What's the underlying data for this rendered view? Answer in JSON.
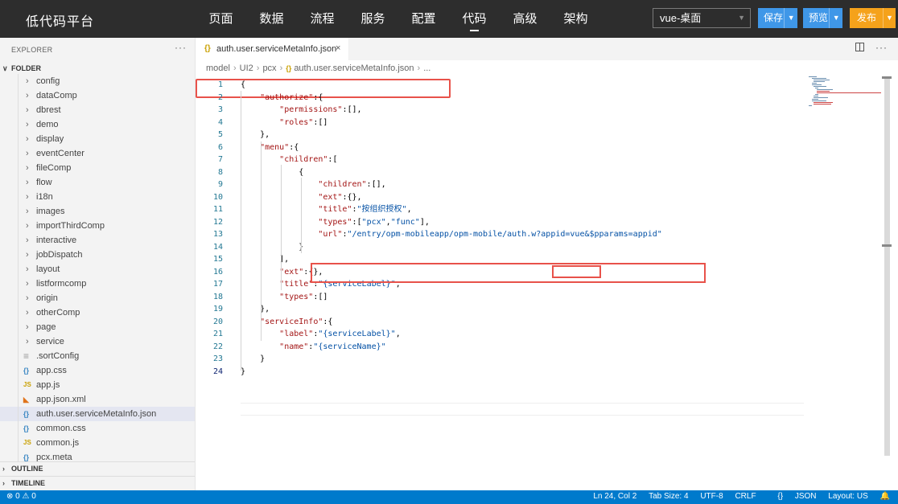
{
  "app": {
    "title": "低代码平台"
  },
  "nav": [
    {
      "label": "页面"
    },
    {
      "label": "数据"
    },
    {
      "label": "流程"
    },
    {
      "label": "服务"
    },
    {
      "label": "配置"
    },
    {
      "label": "代码"
    },
    {
      "label": "高级"
    },
    {
      "label": "架构"
    }
  ],
  "nav_active": "代码",
  "toolbar": {
    "env": "vue-桌面",
    "save": "保存",
    "preview": "预览",
    "publish": "发布"
  },
  "sidebar": {
    "explorer_title": "EXPLORER",
    "more": "···",
    "folder_label": "FOLDER",
    "items": [
      {
        "name": "config",
        "type": "folder"
      },
      {
        "name": "dataComp",
        "type": "folder"
      },
      {
        "name": "dbrest",
        "type": "folder"
      },
      {
        "name": "demo",
        "type": "folder"
      },
      {
        "name": "display",
        "type": "folder"
      },
      {
        "name": "eventCenter",
        "type": "folder"
      },
      {
        "name": "fileComp",
        "type": "folder"
      },
      {
        "name": "flow",
        "type": "folder"
      },
      {
        "name": "i18n",
        "type": "folder"
      },
      {
        "name": "images",
        "type": "folder"
      },
      {
        "name": "importThirdComp",
        "type": "folder"
      },
      {
        "name": "interactive",
        "type": "folder"
      },
      {
        "name": "jobDispatch",
        "type": "folder"
      },
      {
        "name": "layout",
        "type": "folder"
      },
      {
        "name": "listformcomp",
        "type": "folder"
      },
      {
        "name": "origin",
        "type": "folder"
      },
      {
        "name": "otherComp",
        "type": "folder"
      },
      {
        "name": "page",
        "type": "folder"
      },
      {
        "name": "service",
        "type": "folder"
      },
      {
        "name": ".sortConfig",
        "type": "file"
      },
      {
        "name": "app.css",
        "type": "css"
      },
      {
        "name": "app.js",
        "type": "js"
      },
      {
        "name": "app.json.xml",
        "type": "xml"
      },
      {
        "name": "auth.user.serviceMetaInfo.json",
        "type": "json",
        "selected": true
      },
      {
        "name": "common.css",
        "type": "css"
      },
      {
        "name": "common.js",
        "type": "js"
      },
      {
        "name": "pcx.meta",
        "type": "json"
      }
    ],
    "outline_label": "OUTLINE",
    "timeline_label": "TIMELINE"
  },
  "icons": {
    "folder_chevron": "chevron-right-icon",
    "json": "{}",
    "css": "{}",
    "js": "JS",
    "xml": "rss-icon",
    "file": "lines-icon"
  },
  "editor": {
    "tab_name": "auth.user.serviceMetaInfo.json",
    "tab_close": "×",
    "more": "···",
    "breadcrumb": {
      "parts": [
        "model",
        "UI2",
        "pcx"
      ],
      "file": "auth.user.serviceMetaInfo.json",
      "ellipsis": "..."
    },
    "lines": [
      {
        "n": "1",
        "text": "{"
      },
      {
        "n": "2",
        "text": "    \"authorize\":{"
      },
      {
        "n": "3",
        "text": "        \"permissions\":[],"
      },
      {
        "n": "4",
        "text": "        \"roles\":[]"
      },
      {
        "n": "5",
        "text": "    },"
      },
      {
        "n": "6",
        "text": "    \"menu\":{"
      },
      {
        "n": "7",
        "text": "        \"children\":["
      },
      {
        "n": "8",
        "text": "            {"
      },
      {
        "n": "9",
        "text": "                \"children\":[],"
      },
      {
        "n": "10",
        "text": "                \"ext\":{},"
      },
      {
        "n": "11",
        "text": "                \"title\":\"按组织授权\","
      },
      {
        "n": "12",
        "text": "                \"types\":[\"pcx\",\"func\"],"
      },
      {
        "n": "13",
        "text": "                \"url\":\"/entry/opm-mobileapp/opm-mobile/auth.w?appid=vue&$pparams=appid\""
      },
      {
        "n": "14",
        "text": "            }"
      },
      {
        "n": "15",
        "text": "        ],"
      },
      {
        "n": "16",
        "text": "        \"ext\":{},"
      },
      {
        "n": "17",
        "text": "        \"title\":\"{serviceLabel}\","
      },
      {
        "n": "18",
        "text": "        \"types\":[]"
      },
      {
        "n": "19",
        "text": "    },"
      },
      {
        "n": "20",
        "text": "    \"serviceInfo\":{"
      },
      {
        "n": "21",
        "text": "        \"label\":\"{serviceLabel}\","
      },
      {
        "n": "22",
        "text": "        \"name\":\"{serviceName}\""
      },
      {
        "n": "23",
        "text": "    }"
      },
      {
        "n": "24",
        "text": "}"
      }
    ],
    "current_line": "24"
  },
  "status": {
    "errors": "0",
    "warnings": "0",
    "position": "Ln 24, Col 2",
    "tab_size": "Tab Size: 4",
    "encoding": "UTF-8",
    "eol": "CRLF",
    "language": "JSON",
    "layout": "Layout: US"
  },
  "colors": {
    "topbar": "#2d2d2d",
    "primary_btn": "#3f97e8",
    "publish_btn": "#f5a21b",
    "statusbar": "#007acc",
    "highlight": "#e8524a"
  }
}
